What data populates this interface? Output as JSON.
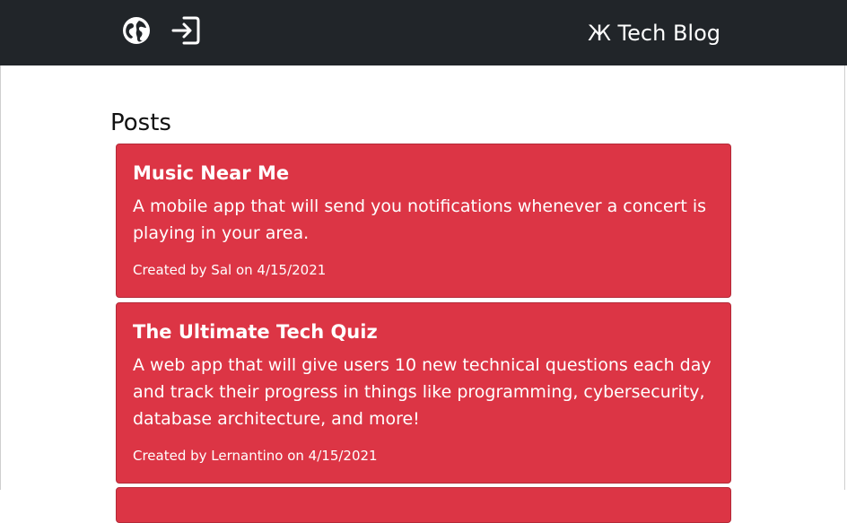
{
  "navbar": {
    "globe_icon": "globe-icon",
    "login_icon": "login-icon",
    "brand": "Ж Tech Blog"
  },
  "main": {
    "section_title": "Posts",
    "posts": [
      {
        "title": "Music Near Me",
        "description": "A mobile app that will send you notifications whenever a concert is playing in your area.",
        "meta": "Created by Sal on 4/15/2021"
      },
      {
        "title": "The Ultimate Tech Quiz",
        "description": "A web app that will give users 10 new technical questions each day and track their progress in things like programming, cybersecurity, database architecture, and more!",
        "meta": "Created by Lernantino on 4/15/2021"
      }
    ]
  },
  "colors": {
    "navbar_bg": "#212529",
    "card_bg": "#dc3545",
    "text_light": "#ffffff"
  }
}
